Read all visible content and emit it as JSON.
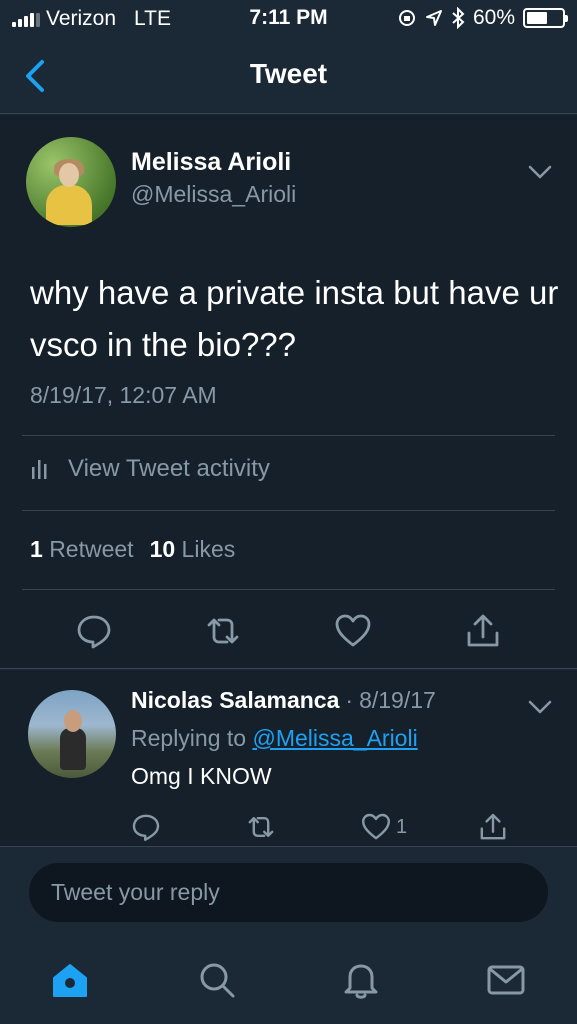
{
  "status_bar": {
    "carrier": "Verizon",
    "network": "LTE",
    "time": "7:11 PM",
    "battery_percent": "60%",
    "battery_level": 0.6
  },
  "nav": {
    "title": "Tweet"
  },
  "tweet": {
    "author_name": "Melissa Arioli",
    "author_handle": "@Melissa_Arioli",
    "text": "why have a private insta but have ur vsco in the bio???",
    "timestamp": "8/19/17, 12:07 AM",
    "activity_label": "View Tweet activity",
    "retweet_count": "1",
    "retweet_label": "Retweet",
    "like_count": "10",
    "like_label": "Likes"
  },
  "reply": {
    "author_name": "Nicolas Salamanca",
    "separator": "·",
    "date": "8/19/17",
    "replying_prefix": "Replying to",
    "replying_handle": "@Melissa_Arioli",
    "text": "Omg I KNOW",
    "like_count": "1"
  },
  "compose": {
    "placeholder": "Tweet your reply"
  },
  "tabs": [
    "home-icon",
    "search-icon",
    "notifications-bell-icon",
    "messages-envelope-icon"
  ],
  "colors": {
    "background": "#15202b",
    "accent": "#1da1f2",
    "secondary_text": "#8899a6",
    "divider": "#38444d"
  }
}
